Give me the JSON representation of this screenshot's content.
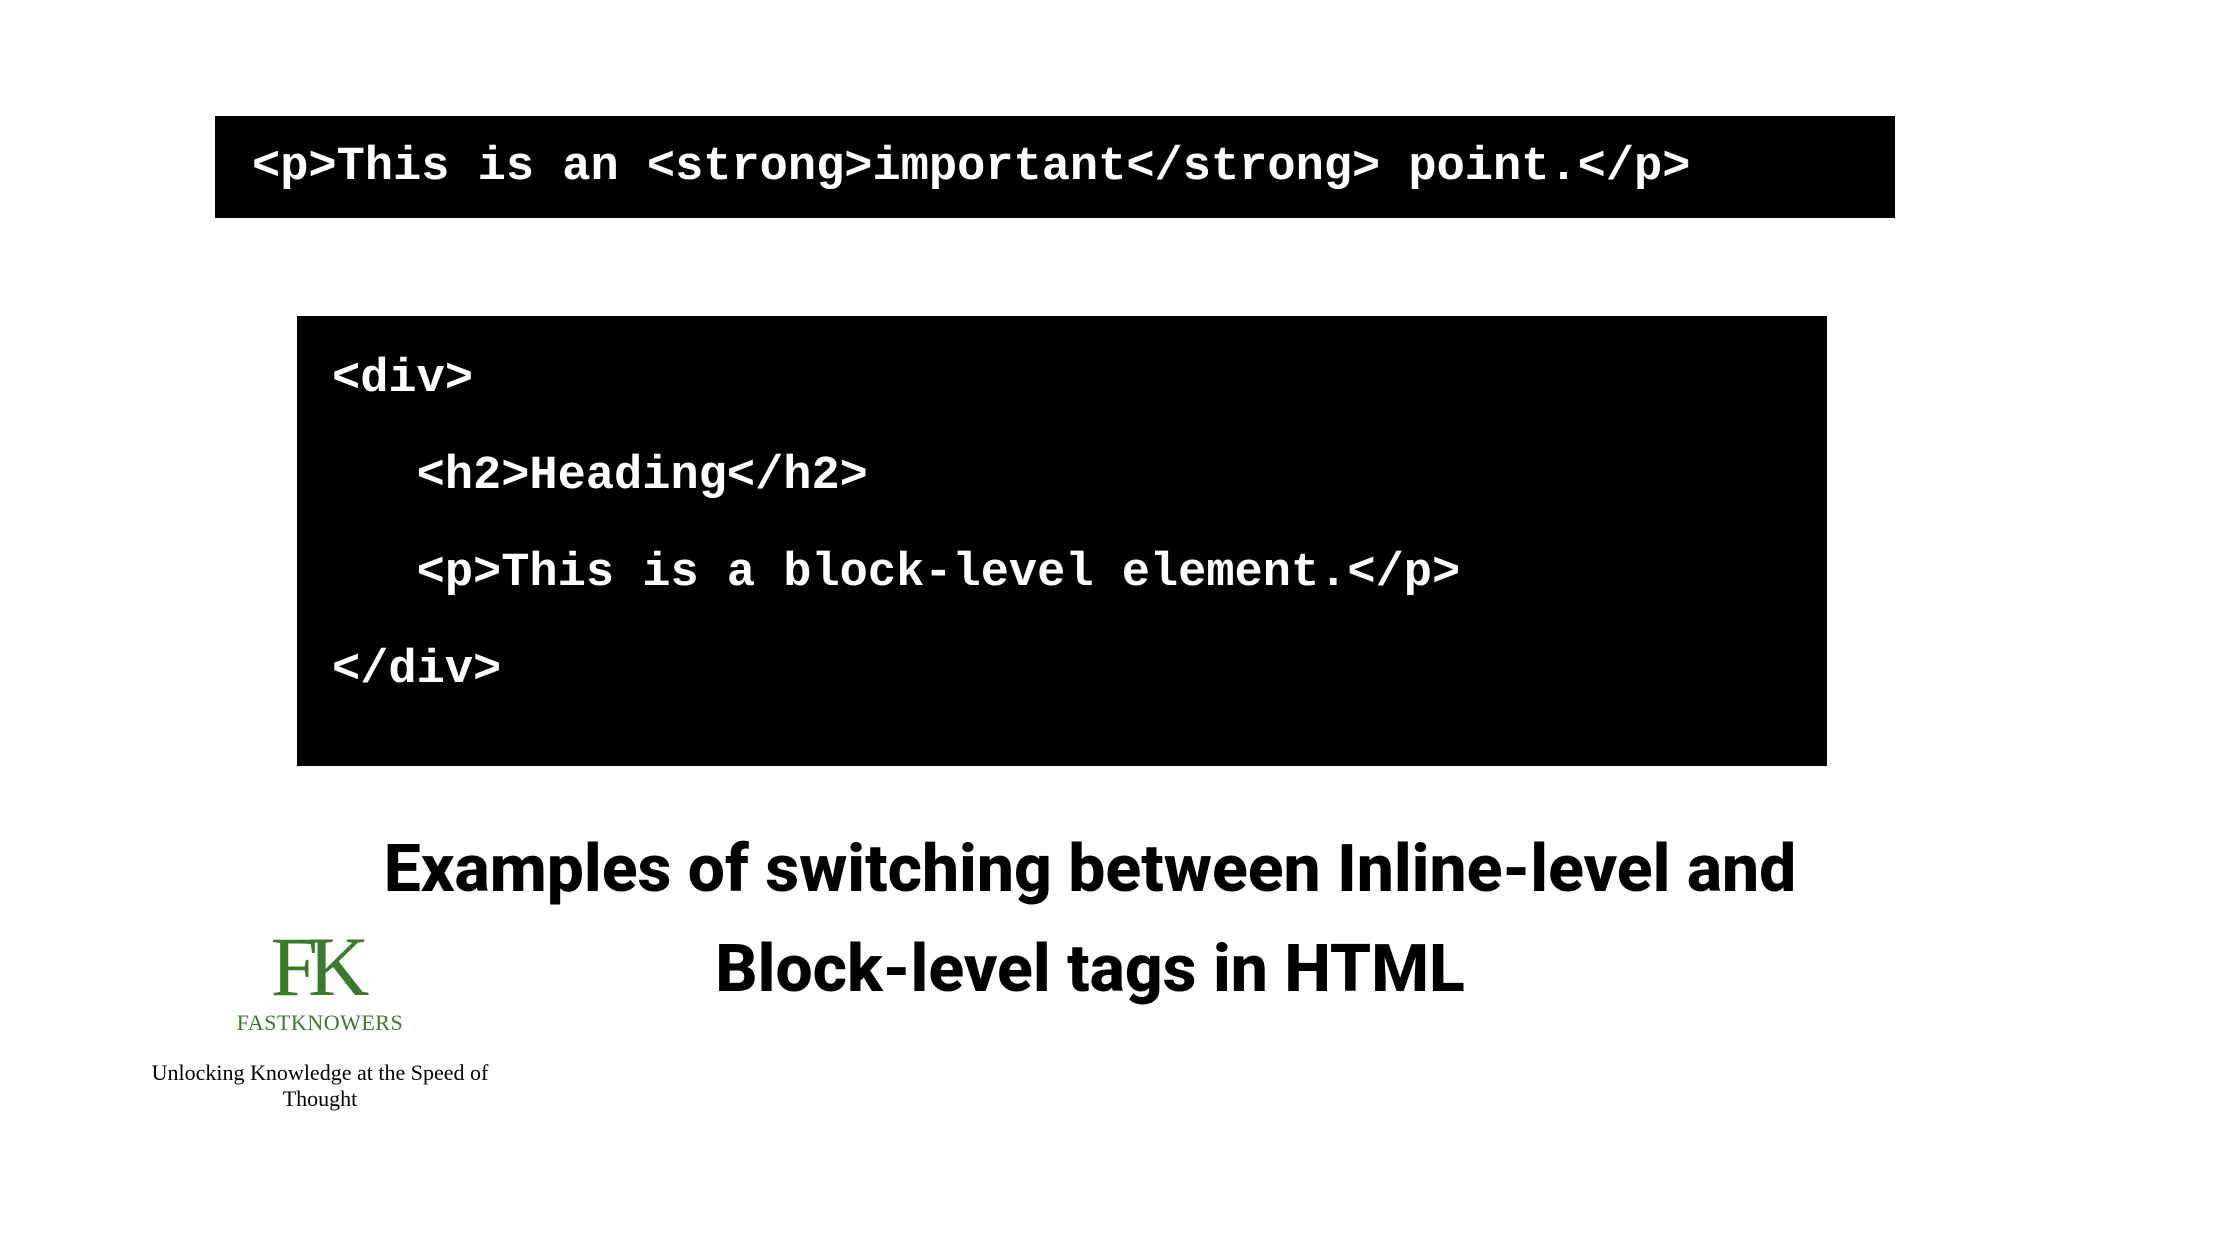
{
  "code_block_1": {
    "line1": "<p>This is an <strong>important</strong> point.</p>"
  },
  "code_block_2": {
    "line1": "<div>",
    "line2": "   <h2>Heading</h2>",
    "line3": "   <p>This is a block-level element.</p>",
    "line4": "</div>"
  },
  "title": "Examples of switching between Inline-level and Block-level tags in HTML",
  "logo": {
    "letter1": "F",
    "letter2": "K",
    "brand": "FASTKNOWERS",
    "tagline": "Unlocking Knowledge at the Speed of Thought"
  }
}
